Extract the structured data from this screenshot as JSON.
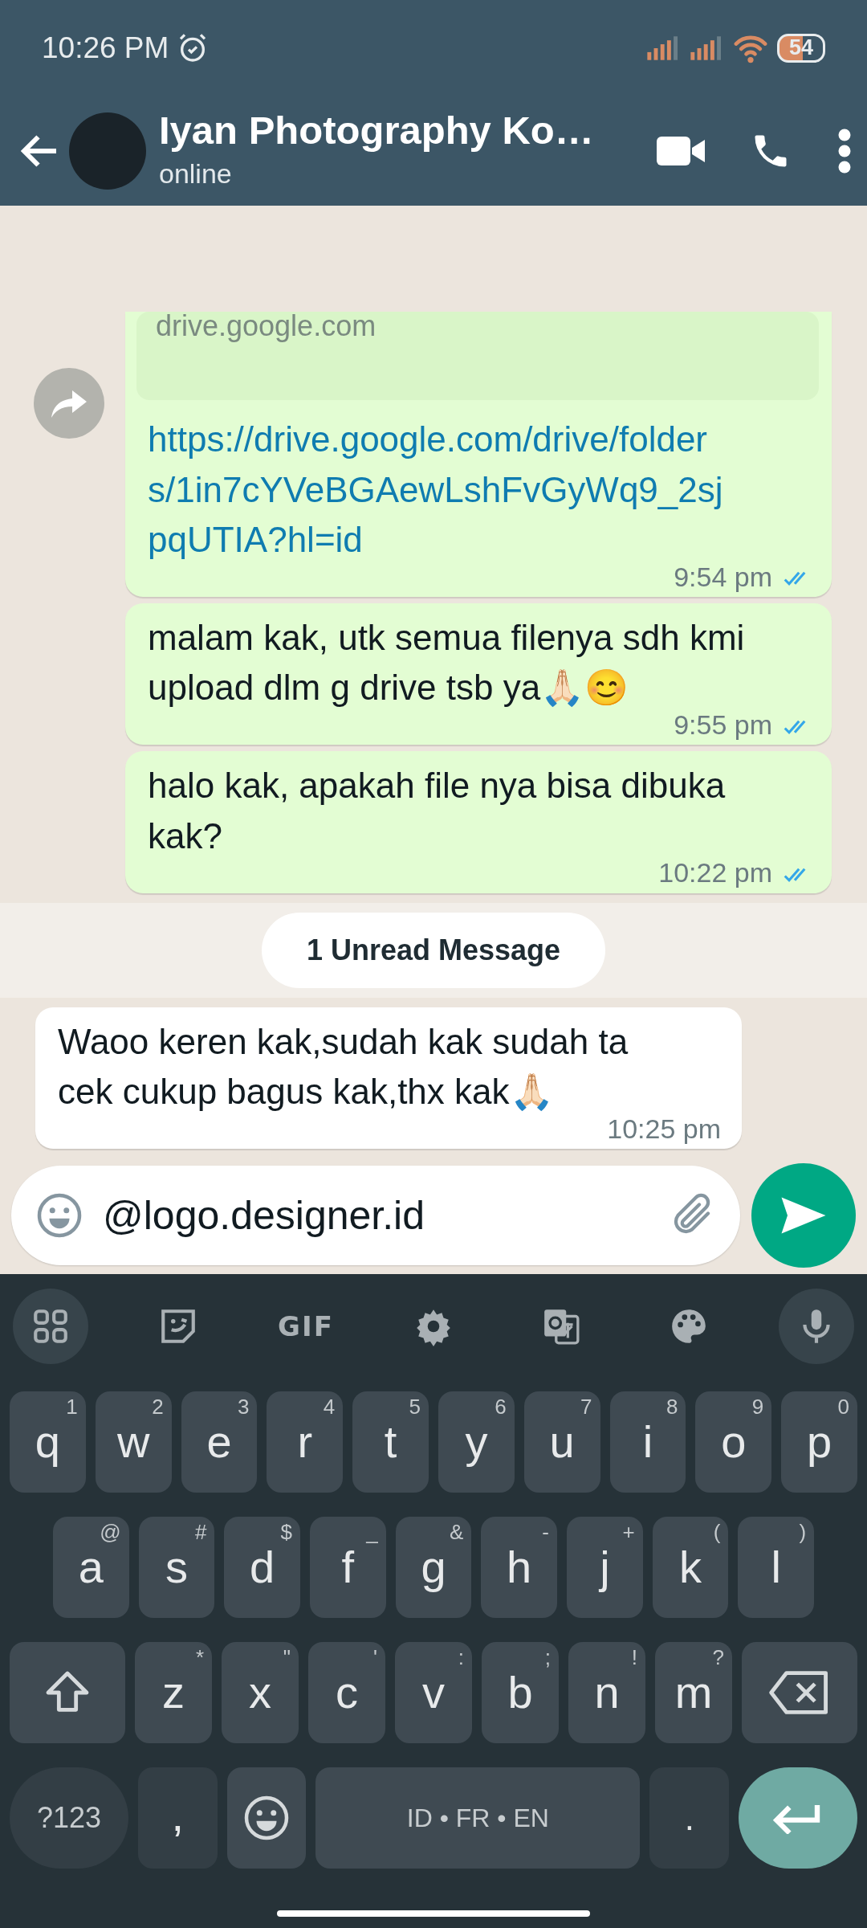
{
  "status_bar": {
    "time": "10:26 PM",
    "battery": "54"
  },
  "header": {
    "title": "Iyan Photography Ko…",
    "subtitle": "online"
  },
  "messages": [
    {
      "kind": "outgoing_link",
      "preview": "drive.google.com",
      "text": "https://drive.google.com/drive/folders/1in7cYVeBGAewLshFvGyWq9_2sjpqUTIA?hl=id",
      "time": "9:54 pm",
      "read": true
    },
    {
      "kind": "outgoing_text",
      "text": "malam kak, utk semua filenya sdh kmi upload dlm g drive tsb ya🙏🏻😊",
      "time": "9:55 pm",
      "read": true
    },
    {
      "kind": "outgoing_text",
      "text": "halo kak, apakah file nya bisa dibuka kak?",
      "time": "10:22 pm",
      "read": true
    },
    {
      "kind": "unread_banner",
      "text": "1 Unread Message"
    },
    {
      "kind": "incoming_text",
      "text": "Waoo keren kak,sudah kak sudah ta cek cukup bagus kak,thx kak🙏🏻",
      "time": "10:25 pm"
    }
  ],
  "composer": {
    "value": "@logo.designer.id"
  },
  "keyboard": {
    "toolbar": [
      {
        "kind": "apps"
      },
      {
        "kind": "sticker"
      },
      {
        "kind": "gif",
        "label": "GIF"
      },
      {
        "kind": "settings"
      },
      {
        "kind": "translate"
      },
      {
        "kind": "palette"
      },
      {
        "kind": "mic"
      }
    ],
    "rows": [
      {
        "keys": [
          {
            "kind": "letter",
            "label": "q",
            "hint": "1"
          },
          {
            "kind": "letter",
            "label": "w",
            "hint": "2"
          },
          {
            "kind": "letter",
            "label": "e",
            "hint": "3"
          },
          {
            "kind": "letter",
            "label": "r",
            "hint": "4"
          },
          {
            "kind": "letter",
            "label": "t",
            "hint": "5"
          },
          {
            "kind": "letter",
            "label": "y",
            "hint": "6"
          },
          {
            "kind": "letter",
            "label": "u",
            "hint": "7"
          },
          {
            "kind": "letter",
            "label": "i",
            "hint": "8"
          },
          {
            "kind": "letter",
            "label": "o",
            "hint": "9"
          },
          {
            "kind": "letter",
            "label": "p",
            "hint": "0"
          }
        ]
      },
      {
        "keys": [
          {
            "kind": "letter",
            "label": "a",
            "hint": "@"
          },
          {
            "kind": "letter",
            "label": "s",
            "hint": "#"
          },
          {
            "kind": "letter",
            "label": "d",
            "hint": "$"
          },
          {
            "kind": "letter",
            "label": "f",
            "hint": "_"
          },
          {
            "kind": "letter",
            "label": "g",
            "hint": "&"
          },
          {
            "kind": "letter",
            "label": "h",
            "hint": "-"
          },
          {
            "kind": "letter",
            "label": "j",
            "hint": "+"
          },
          {
            "kind": "letter",
            "label": "k",
            "hint": "("
          },
          {
            "kind": "letter",
            "label": "l",
            "hint": ")"
          }
        ]
      },
      {
        "keys": [
          {
            "kind": "shift"
          },
          {
            "kind": "letter",
            "label": "z",
            "hint": "*"
          },
          {
            "kind": "letter",
            "label": "x",
            "hint": "\""
          },
          {
            "kind": "letter",
            "label": "c",
            "hint": "'"
          },
          {
            "kind": "letter",
            "label": "v",
            "hint": ":"
          },
          {
            "kind": "letter",
            "label": "b",
            "hint": ";"
          },
          {
            "kind": "letter",
            "label": "n",
            "hint": "!"
          },
          {
            "kind": "letter",
            "label": "m",
            "hint": "?"
          },
          {
            "kind": "backspace"
          }
        ]
      },
      {
        "keys": [
          {
            "kind": "symbols",
            "label": "?123"
          },
          {
            "kind": "comma",
            "label": ","
          },
          {
            "kind": "emoji"
          },
          {
            "kind": "space",
            "label": "ID • FR • EN"
          },
          {
            "kind": "period",
            "label": "."
          },
          {
            "kind": "enter"
          }
        ]
      }
    ]
  }
}
